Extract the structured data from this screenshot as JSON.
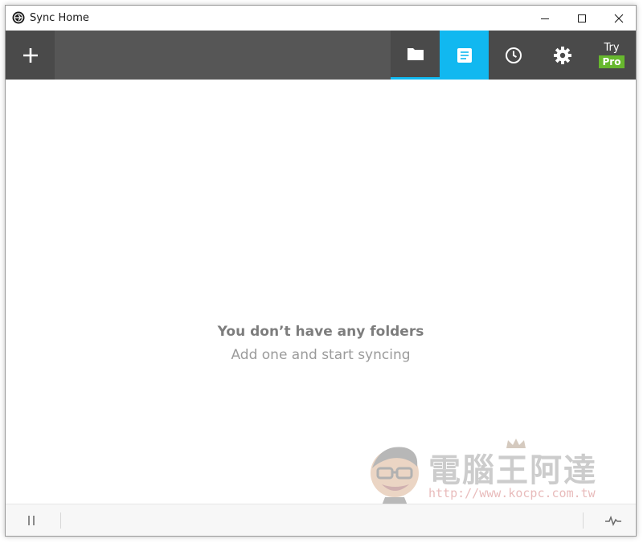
{
  "window": {
    "title": "Sync Home",
    "controls": {
      "minimize_icon": "minimize-icon",
      "maximize_icon": "maximize-icon",
      "close_icon": "close-icon"
    }
  },
  "toolbar": {
    "add_icon": "plus-icon",
    "tabs": [
      {
        "name": "folders",
        "icon": "folder-icon",
        "active": false
      },
      {
        "name": "files",
        "icon": "document-icon",
        "active": true
      },
      {
        "name": "history",
        "icon": "clock-icon",
        "active": false
      },
      {
        "name": "settings",
        "icon": "gear-icon",
        "active": false
      }
    ],
    "try_label": "Try",
    "pro_label": "Pro"
  },
  "empty_state": {
    "title": "You don’t have any folders",
    "subtitle": "Add one and start syncing"
  },
  "watermark": {
    "text": "電腦王阿達",
    "url": "http://www.kocpc.com.tw"
  },
  "statusbar": {
    "pause_icon": "pause-icon",
    "activity_icon": "activity-icon"
  },
  "colors": {
    "toolbar_bg": "#565656",
    "button_bg": "#4a4a4a",
    "accent": "#11b8f0",
    "pro_badge": "#67b82e"
  }
}
